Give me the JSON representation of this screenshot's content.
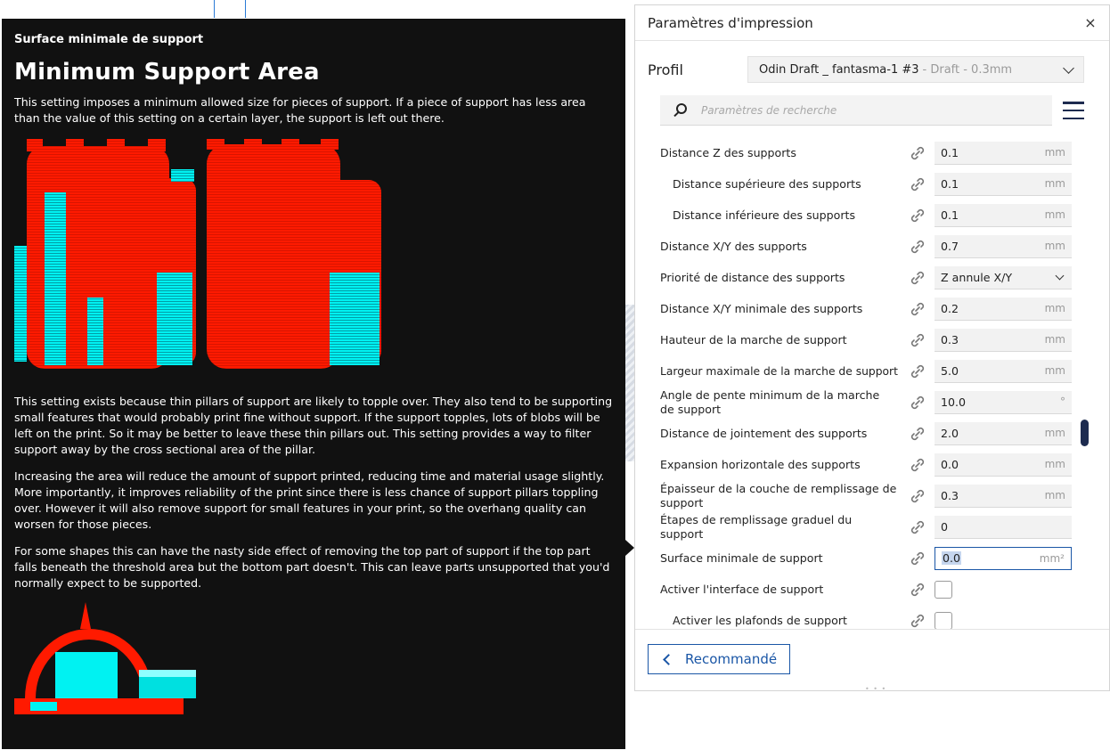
{
  "tooltip": {
    "small_title": "Surface minimale de support",
    "title": "Minimum Support Area",
    "p1": "This setting imposes a minimum allowed size for pieces of support. If a piece of support has less area than the value of this setting on a certain layer, the support is left out there.",
    "p2": "This setting exists because thin pillars of support are likely to topple over. They also tend to be supporting small features that would probably print fine without support. If the support topples, lots of blobs will be left on the print. So it may be better to leave these thin pillars out. This setting provides a way to filter support away by the cross sectional area of the pillar.",
    "p3": "Increasing the area will reduce the amount of support printed, reducing time and material usage slightly. More importantly, it improves reliability of the print since there is less chance of support pillars toppling over. However it will also remove support for small features in your print, so the overhang quality can worsen for those pieces.",
    "p4": "For some shapes this can have the nasty side effect of removing the top part of support if the top part falls beneath the threshold area but the bottom part doesn't. This can leave parts unsupported that you'd normally expect to be supported.",
    "colors": {
      "model": "#ff1a00",
      "support": "#00f2f2",
      "background": "#111111"
    }
  },
  "panel": {
    "title": "Paramètres d'impression",
    "profile_label": "Profil",
    "profile_value": "Odin Draft _ fantasma-1 #3",
    "profile_muted": "- Draft - 0.3mm",
    "search_placeholder": "Paramètres de recherche",
    "recommended_label": "Recommandé",
    "settings": [
      {
        "label": "Distance Z des supports",
        "value": "0.1",
        "unit": "mm"
      },
      {
        "label": "Distance supérieure des supports",
        "value": "0.1",
        "unit": "mm"
      },
      {
        "label": "Distance inférieure des supports",
        "value": "0.1",
        "unit": "mm"
      },
      {
        "label": "Distance X/Y des supports",
        "value": "0.7",
        "unit": "mm"
      },
      {
        "label": "Priorité de distance des supports",
        "value": "Z annule X/Y",
        "unit": ""
      },
      {
        "label": "Distance X/Y minimale des supports",
        "value": "0.2",
        "unit": "mm"
      },
      {
        "label": "Hauteur de la marche de support",
        "value": "0.3",
        "unit": "mm"
      },
      {
        "label": "Largeur maximale de la marche de support",
        "value": "5.0",
        "unit": "mm"
      },
      {
        "label": "Angle de pente minimum de la marche de support",
        "value": "10.0",
        "unit": "°"
      },
      {
        "label": "Distance de jointement des supports",
        "value": "2.0",
        "unit": "mm"
      },
      {
        "label": "Expansion horizontale des supports",
        "value": "0.0",
        "unit": "mm"
      },
      {
        "label": "Épaisseur de la couche de remplissage de support",
        "value": "0.3",
        "unit": "mm"
      },
      {
        "label": "Étapes de remplissage graduel du support",
        "value": "0",
        "unit": ""
      },
      {
        "label": "Surface minimale de support",
        "value": "0.0",
        "unit": "mm²"
      },
      {
        "label": "Activer l'interface de support",
        "value": "",
        "unit": ""
      },
      {
        "label": "Activer les plafonds de support",
        "value": "",
        "unit": ""
      }
    ]
  }
}
